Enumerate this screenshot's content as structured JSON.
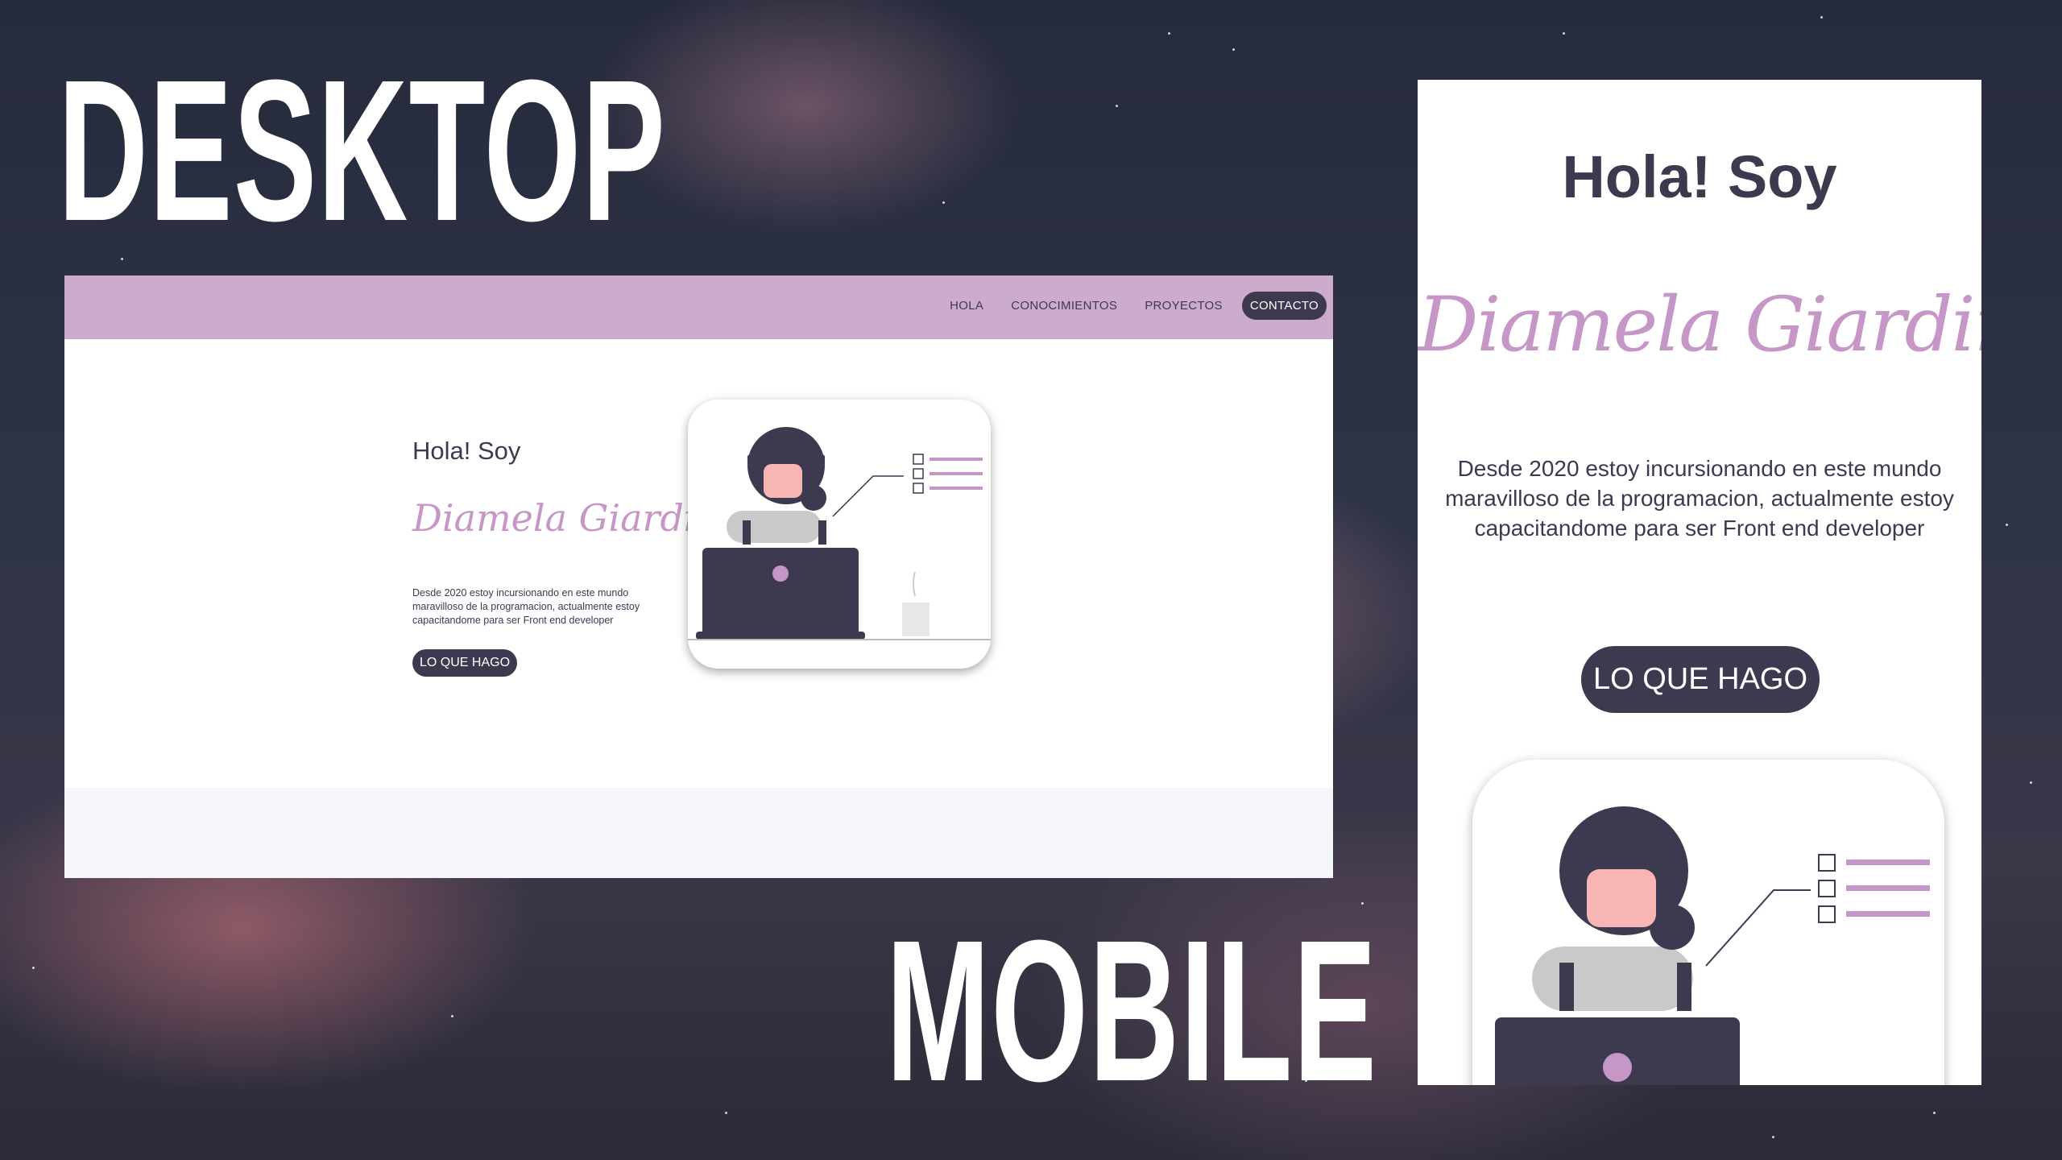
{
  "labels": {
    "desktop": "DESKTOP",
    "mobile": "MOBILE"
  },
  "desktop": {
    "nav": [
      "HOLA",
      "CONOCIMIENTOS",
      "PROYECTOS",
      "CONTACTO"
    ],
    "greeting": "Hola! Soy",
    "name": "Diamela Giardini",
    "description": "Desde 2020 estoy incursionando en este mundo maravilloso de la programacion, actualmente estoy capacitandome para ser Front end developer",
    "cta": "LO QUE HAGO"
  },
  "mobile": {
    "greeting": "Hola! Soy",
    "name": "Diamela Giardini",
    "description": "Desde 2020 estoy incursionando en este mundo maravilloso de la programacion, actualmente estoy capacitandome para ser Front end developer",
    "cta": "LO QUE HAGO"
  },
  "colors": {
    "accent": "#cdabcd",
    "dark": "#3d3a50",
    "name_color": "#c596c6",
    "footer": "#f5f6f9"
  }
}
